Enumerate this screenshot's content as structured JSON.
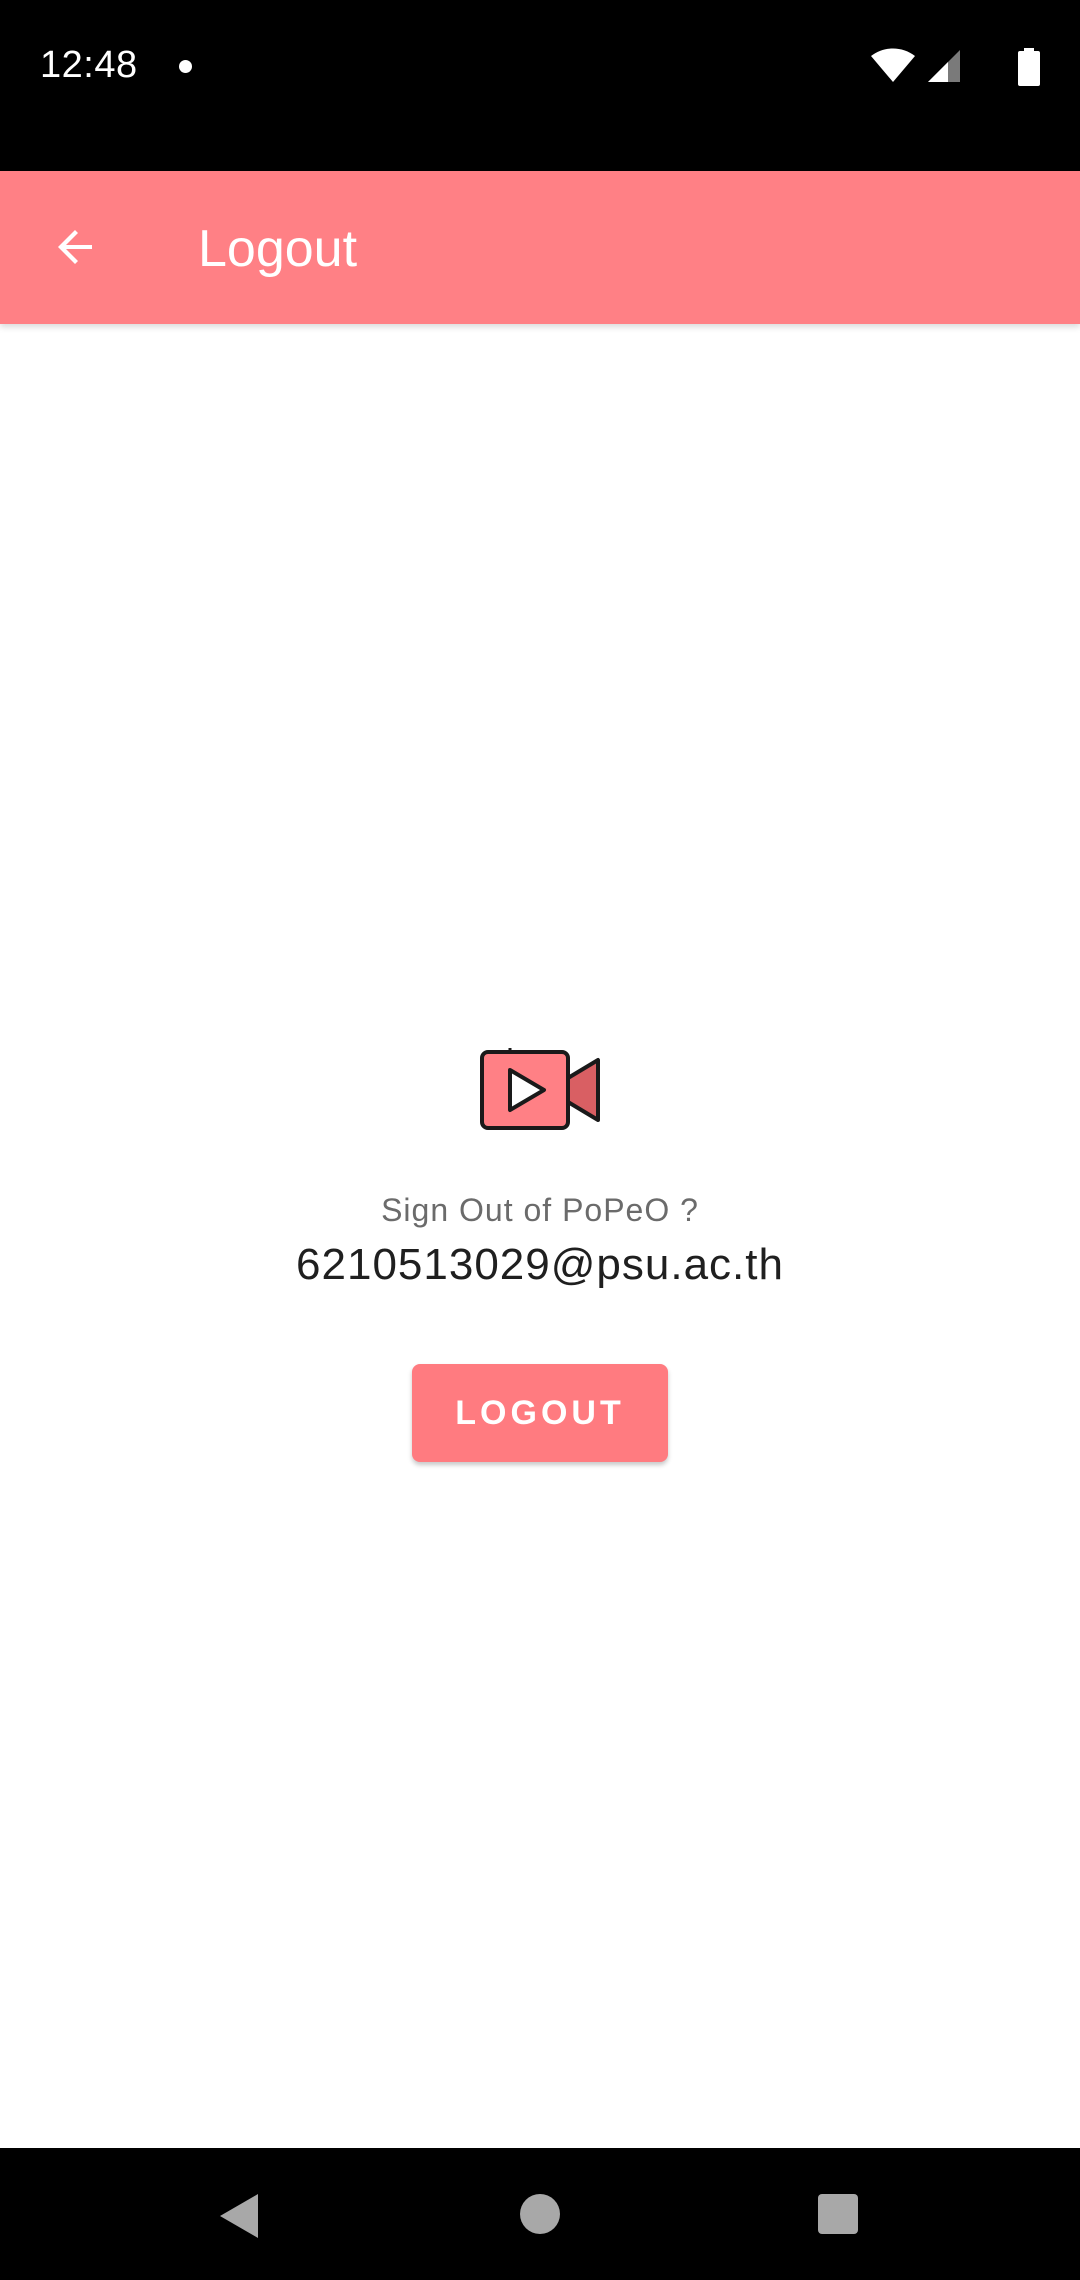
{
  "status_bar": {
    "time": "12:48",
    "icons": [
      "notification-dot",
      "wifi-icon",
      "signal-icon",
      "battery-icon"
    ]
  },
  "app_bar": {
    "title": "Logout",
    "back_icon": "arrow-left-icon",
    "color": "#ff8085"
  },
  "content": {
    "app_icon": "video-camera-play-icon",
    "prompt": "Sign Out of PoPeO ?",
    "email": "6210513029@psu.ac.th",
    "logout_label": "LOGOUT",
    "button_color": "#ff7b80"
  },
  "nav_bar": {
    "icons": [
      "nav-back-icon",
      "nav-home-icon",
      "nav-recents-icon"
    ]
  }
}
